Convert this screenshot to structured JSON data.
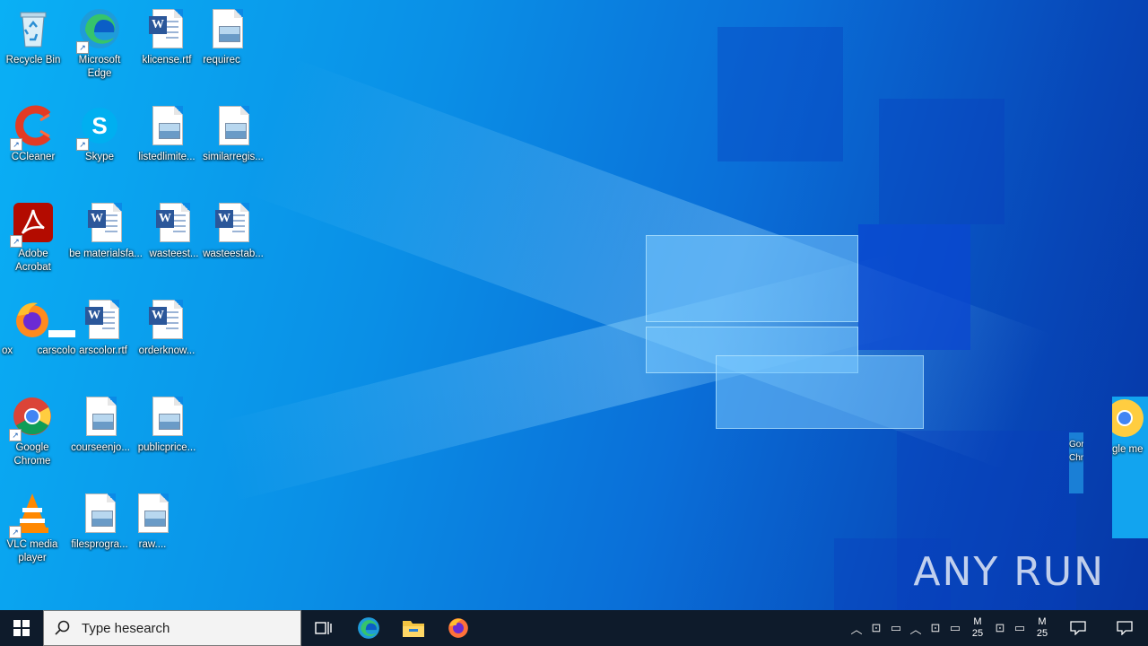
{
  "desktop": {
    "icons": [
      {
        "label": "Recycle Bin",
        "name": "recycle-bin-icon"
      },
      {
        "label": "Microsoft Edge",
        "name": "edge-icon"
      },
      {
        "label": "klicense.rtf",
        "name": "word-doc-icon"
      },
      {
        "label": "requirec",
        "name": "picture-file-icon"
      },
      {
        "label": "CCleaner",
        "name": "ccleaner-icon"
      },
      {
        "label": "Skype",
        "name": "skype-icon"
      },
      {
        "label": "listedlimite...",
        "name": "picture-file-icon"
      },
      {
        "label": "similarregis...",
        "name": "picture-file-icon"
      },
      {
        "label": "Adobe Acrobat",
        "name": "acrobat-icon"
      },
      {
        "label": "be materialsfa...",
        "name": "word-doc-icon"
      },
      {
        "label": "wasteest...",
        "name": "word-doc-icon"
      },
      {
        "label": "wasteestab...",
        "name": "word-doc-icon"
      },
      {
        "label": "ox",
        "name": "firefox-icon"
      },
      {
        "label": "carscolo",
        "name": "blank-file-icon"
      },
      {
        "label": "arscolor.rtf",
        "name": "word-doc-icon"
      },
      {
        "label": "orderknow...",
        "name": "word-doc-icon"
      },
      {
        "label": "Google Chrome",
        "name": "chrome-icon"
      },
      {
        "label": "courseenjo...",
        "name": "picture-file-icon"
      },
      {
        "label": "publicprice...",
        "name": "picture-file-icon"
      },
      {
        "label": "VLC media player",
        "name": "vlc-icon"
      },
      {
        "label": "filesprogra...",
        "name": "picture-file-icon"
      },
      {
        "label": "raw....",
        "name": "picture-file-icon"
      },
      {
        "label": "Gor Chr",
        "name": "chrome-icon"
      },
      {
        "label": "gle me",
        "name": "chrome-icon"
      }
    ],
    "watermark": "ANY RUN"
  },
  "taskbar": {
    "search_placeholder": "Type hesearch",
    "clock_line1": "M",
    "clock_line2": "25",
    "clock2_line1": "M",
    "clock2_line2": "25",
    "colors": {
      "bar": "#0e1b2b",
      "accent": "#0078d7"
    }
  }
}
